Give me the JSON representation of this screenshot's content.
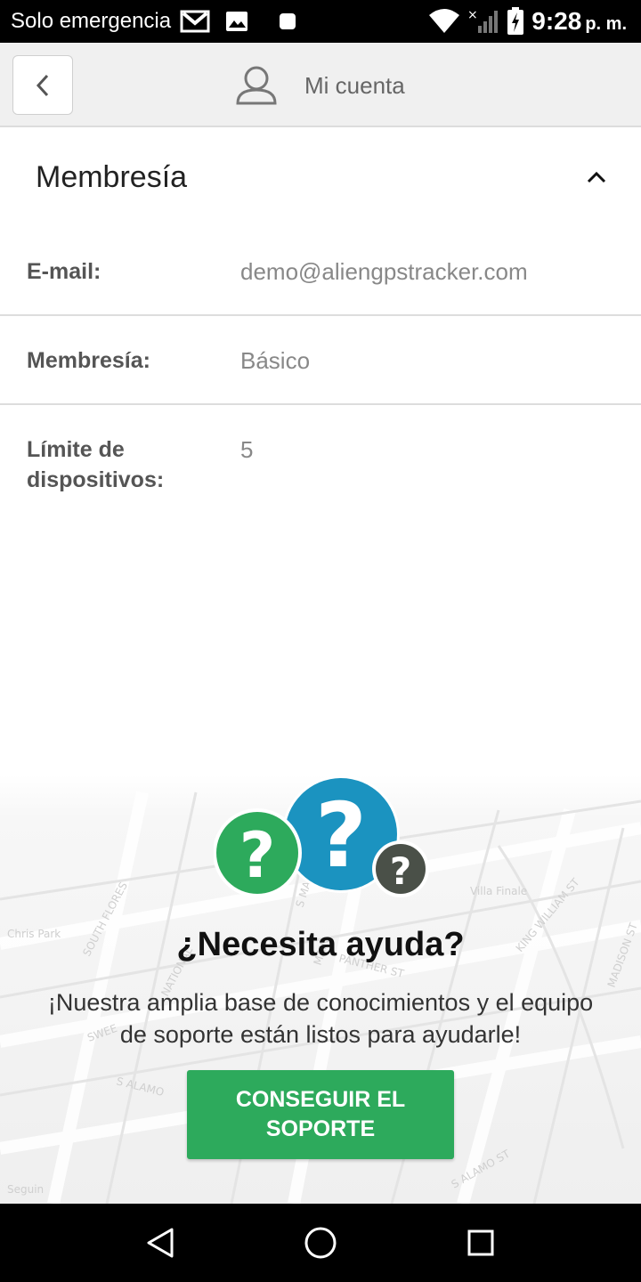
{
  "status_bar": {
    "carrier": "Solo emergencia",
    "time": "9:28",
    "ampm": "p. m."
  },
  "header": {
    "title": "Mi cuenta",
    "back_icon": "chevron-left-icon",
    "user_icon": "user-icon"
  },
  "section": {
    "title": "Membresía",
    "toggle_icon": "chevron-up-icon"
  },
  "rows": [
    {
      "label": "E-mail:",
      "value": "demo@aliengpstracker.com"
    },
    {
      "label": "Membresía:",
      "value": "Básico"
    },
    {
      "label": "Límite de dispositivos:",
      "value": "5"
    }
  ],
  "help": {
    "title": "¿Necesita ayuda?",
    "description": "¡Nuestra amplia base de conocimientos y el equipo de soporte están listos para ayudarle!",
    "button_label": "CONSEGUIR EL SOPORTE",
    "map_labels": [
      "Chris Park",
      "SOUTH FLORES",
      "NATIONAL",
      "S MAIN",
      "MAIN",
      "PANTHER ST",
      "KING WILLIAM ST",
      "Villa Finale",
      "MADISON ST",
      "S ALAMO",
      "S ALAMO ST",
      "SWEE",
      "Seguin"
    ],
    "colors": {
      "green": "#2daa5c",
      "blue": "#1b93c0",
      "dark": "#4a5048"
    }
  },
  "nav": {
    "back_icon": "triangle-back-icon",
    "home_icon": "circle-home-icon",
    "recents_icon": "square-recents-icon"
  }
}
